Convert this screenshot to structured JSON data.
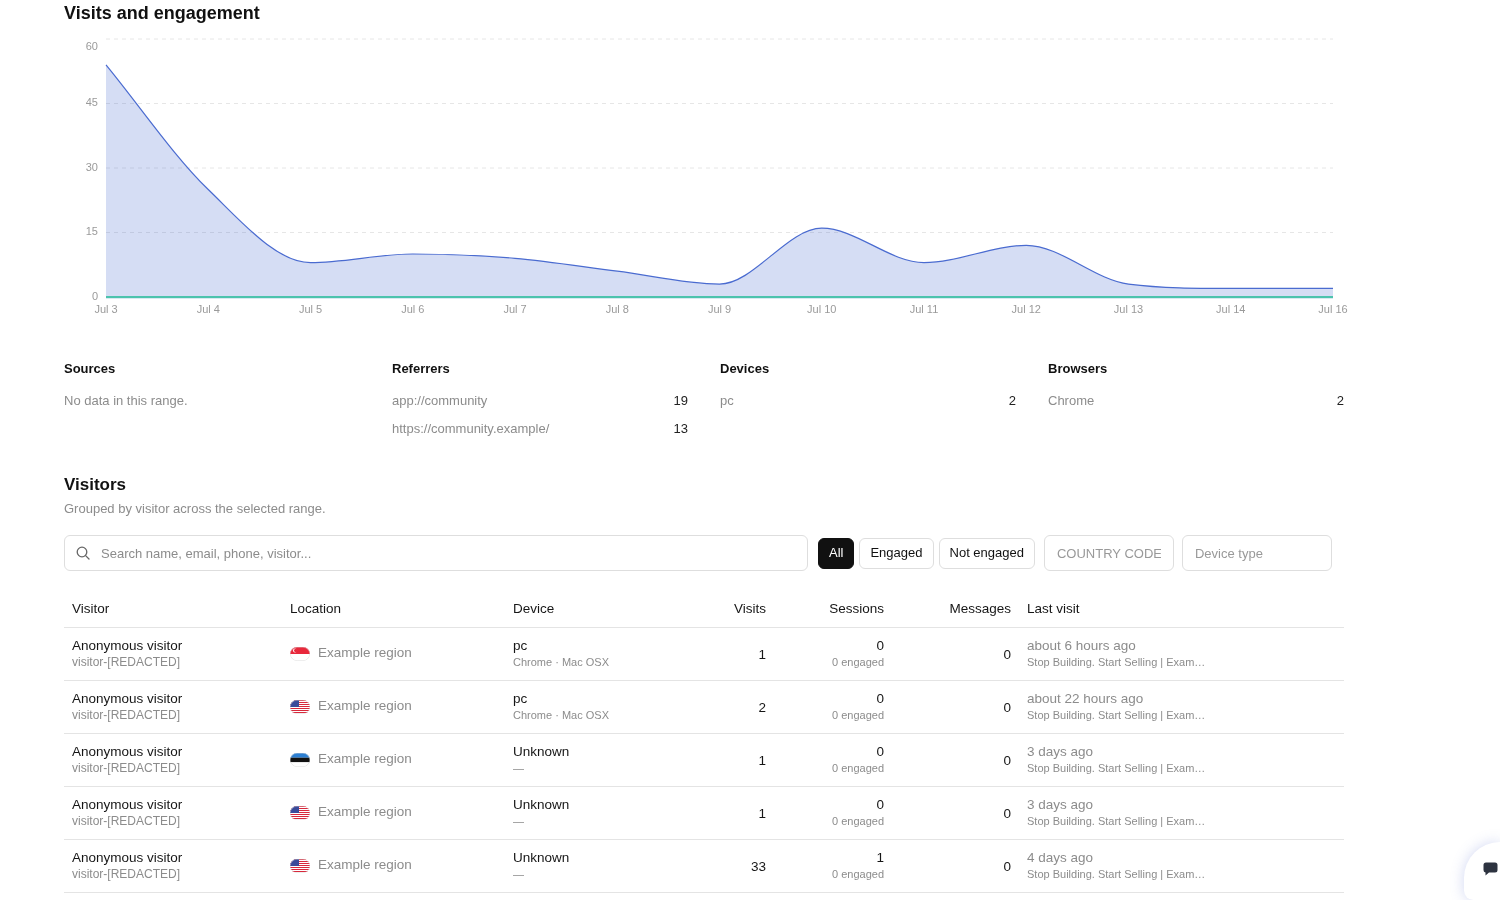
{
  "engagement": {
    "title": "Visits and engagement",
    "chart_data": {
      "type": "area",
      "categories": [
        "Jul 3",
        "Jul 4",
        "Jul 5",
        "Jul 6",
        "Jul 7",
        "Jul 8",
        "Jul 9",
        "Jul 10",
        "Jul 11",
        "Jul 12",
        "Jul 13",
        "Jul 14",
        "Jul 16"
      ],
      "series": [
        {
          "color": "#4a6bd0",
          "values": [
            54,
            25,
            8,
            10,
            9,
            6,
            3,
            16,
            8,
            12,
            3,
            2,
            2
          ]
        },
        {
          "color": "#4cc3ad",
          "values": [
            0,
            0,
            0,
            0,
            0,
            0,
            0,
            0,
            0,
            0,
            0,
            0,
            0
          ]
        }
      ],
      "ylim": [
        0,
        60
      ],
      "yticks": [
        0,
        15,
        30,
        45,
        60
      ],
      "grid": true
    }
  },
  "breakdowns": [
    {
      "title": "Sources",
      "empty_text": "No data in this range."
    },
    {
      "title": "Referrers",
      "items": [
        {
          "label": "app://community",
          "value": "19"
        },
        {
          "label": "https://community.example/",
          "value": "13"
        }
      ]
    },
    {
      "title": "Devices",
      "items": [
        {
          "label": "pc",
          "value": "2"
        }
      ]
    },
    {
      "title": "Browsers",
      "items": [
        {
          "label": "Chrome",
          "value": "2"
        }
      ]
    }
  ],
  "visitors": {
    "title": "Visitors",
    "subtitle": "Grouped by visitor across the selected range.",
    "search": {
      "placeholder": "Search name, email, phone, visitor..."
    },
    "filters": [
      {
        "label": "All",
        "selected": true
      },
      {
        "label": "Engaged",
        "selected": false
      },
      {
        "label": "Not engaged",
        "selected": false
      }
    ],
    "country_code": {
      "placeholder": "COUNTRY CODE"
    },
    "device_type": {
      "placeholder": "Device type"
    },
    "table": {
      "columns": [
        "Visitor",
        "Location",
        "Device",
        "Visits",
        "Sessions",
        "Messages",
        "Last visit"
      ],
      "rows": [
        {
          "name": "Anonymous visitor",
          "visitor_id": "visitor-[REDACTED]",
          "flag": {
            "kind": "sg"
          },
          "location": "Example region",
          "device": "pc",
          "device_detail": "Chrome · Mac OSX",
          "visits": "1",
          "sessions": "0",
          "sessions_engaged": "0 engaged",
          "messages": "0",
          "last_visit": "about 6 hours ago",
          "last_page": "Stop Building. Start Selling | Exam…"
        },
        {
          "name": "Anonymous visitor",
          "visitor_id": "visitor-[REDACTED]",
          "flag": {
            "kind": "us"
          },
          "location": "Example region",
          "device": "pc",
          "device_detail": "Chrome · Mac OSX",
          "visits": "2",
          "sessions": "0",
          "sessions_engaged": "0 engaged",
          "messages": "0",
          "last_visit": "about 22 hours ago",
          "last_page": "Stop Building. Start Selling | Exam…"
        },
        {
          "name": "Anonymous visitor",
          "visitor_id": "visitor-[REDACTED]",
          "flag": {
            "kind": "ee"
          },
          "location": "Example region",
          "device": "Unknown",
          "device_detail": "—",
          "visits": "1",
          "sessions": "0",
          "sessions_engaged": "0 engaged",
          "messages": "0",
          "last_visit": "3 days ago",
          "last_page": "Stop Building. Start Selling | Exam…"
        },
        {
          "name": "Anonymous visitor",
          "visitor_id": "visitor-[REDACTED]",
          "flag": {
            "kind": "us"
          },
          "location": "Example region",
          "device": "Unknown",
          "device_detail": "—",
          "visits": "1",
          "sessions": "0",
          "sessions_engaged": "0 engaged",
          "messages": "0",
          "last_visit": "3 days ago",
          "last_page": "Stop Building. Start Selling | Exam…"
        },
        {
          "name": "Anonymous visitor",
          "visitor_id": "visitor-[REDACTED]",
          "flag": {
            "kind": "us"
          },
          "location": "Example region",
          "device": "Unknown",
          "device_detail": "—",
          "visits": "33",
          "sessions": "1",
          "sessions_engaged": "0 engaged",
          "messages": "0",
          "last_visit": "4 days ago",
          "last_page": "Stop Building. Start Selling | Exam…"
        }
      ]
    }
  }
}
